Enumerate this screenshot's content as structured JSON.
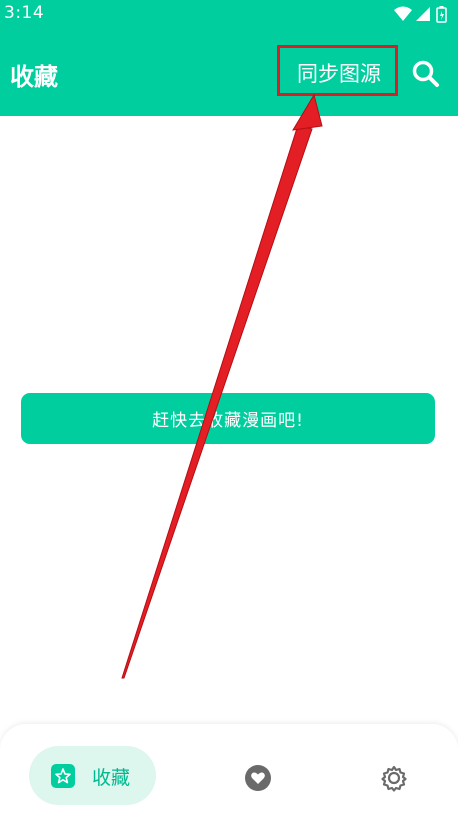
{
  "status_bar": {
    "time": "3:14",
    "icons": [
      "wifi-icon",
      "cellular-signal-icon",
      "battery-icon"
    ]
  },
  "app_bar": {
    "title": "收藏",
    "sync_label": "同步图源",
    "search_icon": "search-icon"
  },
  "main": {
    "empty_cta_label": "赶快去收藏漫画吧!"
  },
  "bottom_nav": {
    "items": [
      {
        "label": "收藏",
        "icon": "star-icon",
        "active": true
      },
      {
        "label": "",
        "icon": "heart-icon",
        "active": false
      },
      {
        "label": "",
        "icon": "settings-gear-icon",
        "active": false
      }
    ]
  },
  "colors": {
    "accent": "#00ce9f",
    "active_tab_bg": "#ddf6ee",
    "annotation_red": "#d81f26"
  }
}
